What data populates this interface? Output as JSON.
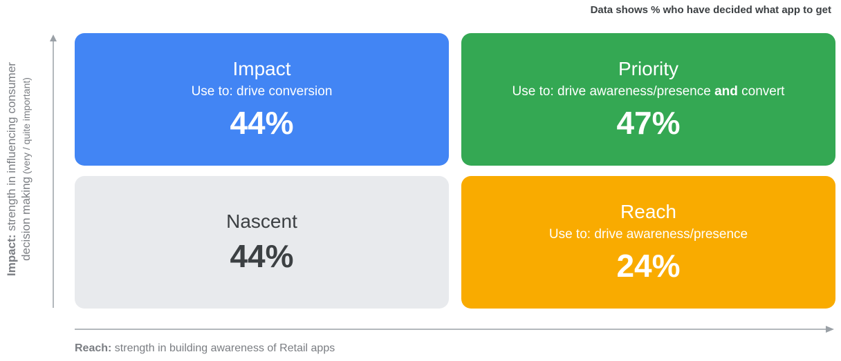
{
  "header": {
    "note": "Data shows % who have decided what app to get"
  },
  "y_axis": {
    "label_bold": "Impact:",
    "label_rest": " strength in influencing consumer",
    "label_line2": "decision making",
    "label_small": " (very / quite important)"
  },
  "x_axis": {
    "label_bold": "Reach:",
    "label_rest": " strength in building awareness of Retail apps"
  },
  "quadrants": {
    "impact": {
      "title": "Impact",
      "use": "Use to: drive conversion",
      "value": "44%",
      "color": "#4285f4"
    },
    "priority": {
      "title": "Priority",
      "use_before": "Use to: drive awareness/presence ",
      "use_bold": "and",
      "use_after": " convert",
      "value": "47%",
      "color": "#34a853"
    },
    "nascent": {
      "title": "Nascent",
      "value": "44%",
      "color": "#e8eaed"
    },
    "reach": {
      "title": "Reach",
      "use": "Use to: drive awareness/presence",
      "value": "24%",
      "color": "#f9ab00"
    }
  }
}
